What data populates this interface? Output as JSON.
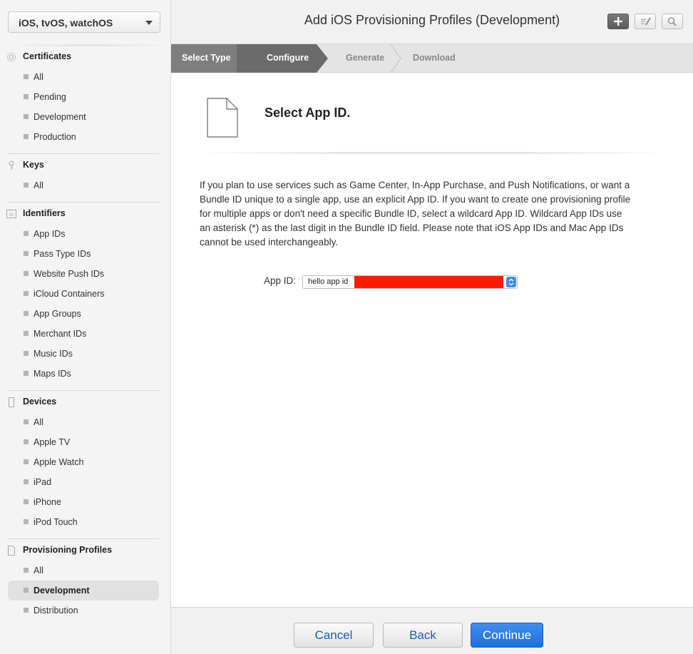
{
  "sidebar": {
    "platform": "iOS, tvOS, watchOS",
    "sections": {
      "certificates": {
        "title": "Certificates",
        "icon": "certificate-icon",
        "items": [
          "All",
          "Pending",
          "Development",
          "Production"
        ]
      },
      "keys": {
        "title": "Keys",
        "icon": "key-icon",
        "items": [
          "All"
        ]
      },
      "identifiers": {
        "title": "Identifiers",
        "icon": "id-icon",
        "items": [
          "App IDs",
          "Pass Type IDs",
          "Website Push IDs",
          "iCloud Containers",
          "App Groups",
          "Merchant IDs",
          "Music IDs",
          "Maps IDs"
        ]
      },
      "devices": {
        "title": "Devices",
        "icon": "device-icon",
        "items": [
          "All",
          "Apple TV",
          "Apple Watch",
          "iPad",
          "iPhone",
          "iPod Touch"
        ]
      },
      "profiles": {
        "title": "Provisioning Profiles",
        "icon": "document-icon",
        "items": [
          "All",
          "Development",
          "Distribution"
        ],
        "active": "Development"
      }
    }
  },
  "header": {
    "title": "Add iOS Provisioning Profiles (Development)",
    "buttons": [
      "plus-icon",
      "edit-icon",
      "search-icon"
    ]
  },
  "steps": [
    "Select Type",
    "Configure",
    "Generate",
    "Download"
  ],
  "main": {
    "title": "Select App ID.",
    "description": "If you plan to use services such as Game Center, In-App Purchase, and Push Notifications, or want a Bundle ID unique to a single app, use an explicit App ID. If you want to create one provisioning profile for multiple apps or don't need a specific Bundle ID, select a wildcard App ID. Wildcard App IDs use an asterisk (*) as the last digit in the Bundle ID field. Please note that iOS App IDs and Mac App IDs cannot be used interchangeably.",
    "app_id_label": "App ID:",
    "app_id_value": "hello app id"
  },
  "footer": {
    "cancel": "Cancel",
    "back": "Back",
    "continue": "Continue"
  },
  "colors": {
    "accent": "#1f6fd8",
    "redaction": "#fc1b00"
  }
}
